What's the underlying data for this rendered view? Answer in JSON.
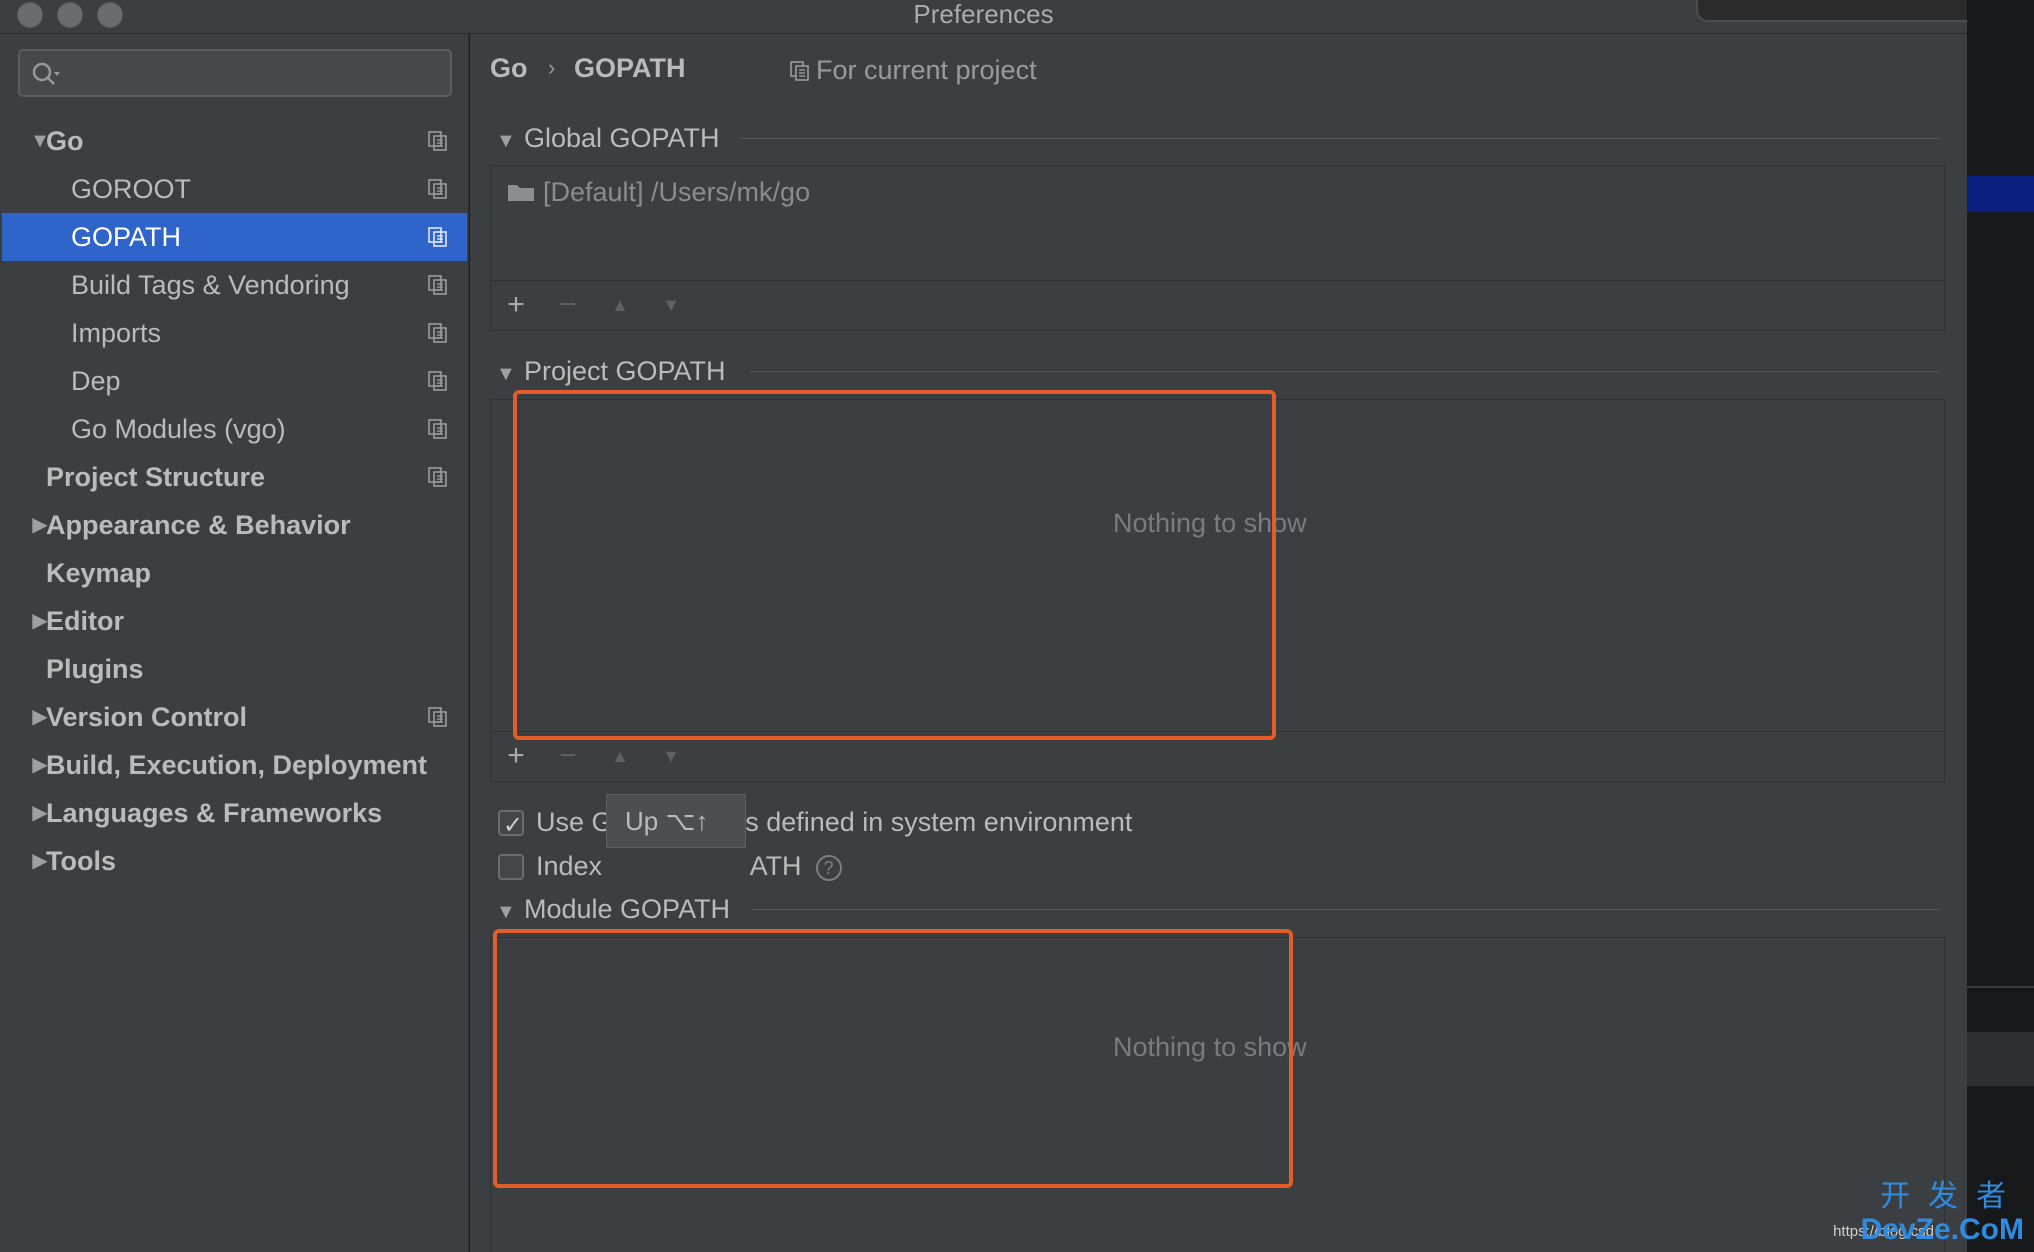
{
  "window": {
    "title": "Preferences"
  },
  "sidebar": {
    "search": {
      "placeholder": ""
    },
    "items": [
      {
        "label": "Go",
        "expanded": true,
        "bold": true,
        "has_copy_icon": true
      },
      {
        "label": "GOROOT",
        "has_copy_icon": true
      },
      {
        "label": "GOPATH",
        "selected": true,
        "has_copy_icon": true
      },
      {
        "label": "Build Tags & Vendoring",
        "has_copy_icon": true
      },
      {
        "label": "Imports",
        "has_copy_icon": true
      },
      {
        "label": "Dep",
        "has_copy_icon": true
      },
      {
        "label": "Go Modules (vgo)",
        "has_copy_icon": true
      },
      {
        "label": "Project Structure",
        "bold": true,
        "has_copy_icon": true
      },
      {
        "label": "Appearance & Behavior",
        "bold": true,
        "collapsed": true
      },
      {
        "label": "Keymap",
        "bold": true
      },
      {
        "label": "Editor",
        "bold": true,
        "collapsed": true
      },
      {
        "label": "Plugins",
        "bold": true
      },
      {
        "label": "Version Control",
        "bold": true,
        "collapsed": true,
        "has_copy_icon": true
      },
      {
        "label": "Build, Execution, Deployment",
        "bold": true,
        "collapsed": true
      },
      {
        "label": "Languages & Frameworks",
        "bold": true,
        "collapsed": true
      },
      {
        "label": "Tools",
        "bold": true,
        "collapsed": true
      }
    ]
  },
  "breadcrumb": {
    "parent": "Go",
    "separator": "›",
    "current": "GOPATH"
  },
  "scope_label": "For current project",
  "sections": {
    "global": {
      "title": "Global GOPATH",
      "entries": [
        "[Default] /Users/mk/go"
      ]
    },
    "project": {
      "title": "Project GOPATH",
      "empty_text": "Nothing to show"
    },
    "module": {
      "title": "Module GOPATH",
      "empty_text": "Nothing to show"
    }
  },
  "toolbar": {
    "add": "+",
    "remove": "−",
    "up": "▲",
    "down": "▼"
  },
  "options": {
    "use_system_gopath": {
      "label_visible_start": "Use G",
      "label_visible_end": "t's defined in system environment",
      "checked": true
    },
    "index_entire_gopath": {
      "label_visible_start": "Index ",
      "label_visible_end": "ATH",
      "checked": false
    }
  },
  "tooltip": {
    "text": "Up  ⌥↑"
  },
  "watermark": {
    "chinese": "开发者",
    "brand": "DevZe.CoM",
    "url": "https://blog.csd"
  },
  "colors": {
    "selection": "#2f65ca",
    "highlight_box": "#e25d2a",
    "panel_bg": "#3c3f41"
  }
}
